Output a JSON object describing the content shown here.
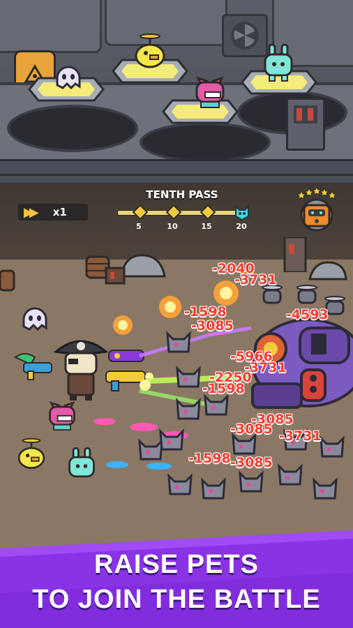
{
  "hud": {
    "speed_icon": "fast-forward-icon",
    "speed_label": "x1",
    "pass": {
      "title": "TENTH PASS",
      "milestones": [
        "5",
        "10",
        "15",
        "20"
      ],
      "boss_icon": "cat-skull-icon"
    },
    "rank_badge": {
      "icon": "robot-icon",
      "stars": 5
    }
  },
  "damage_numbers": [
    "-2040",
    "-3731",
    "-1598",
    "-3085",
    "-4593",
    "-5966",
    "-3731",
    "-2250",
    "-1598",
    "-3085",
    "-3085",
    "-3731",
    "-1598",
    "-3085"
  ],
  "banner": {
    "line1": "RAISE PETS",
    "line2": "TO JOIN THE BATTLE"
  },
  "colors": {
    "banner_purple": "#8a33e6",
    "damage_red": "#ff3b30",
    "gold": "#f4cb3b"
  }
}
